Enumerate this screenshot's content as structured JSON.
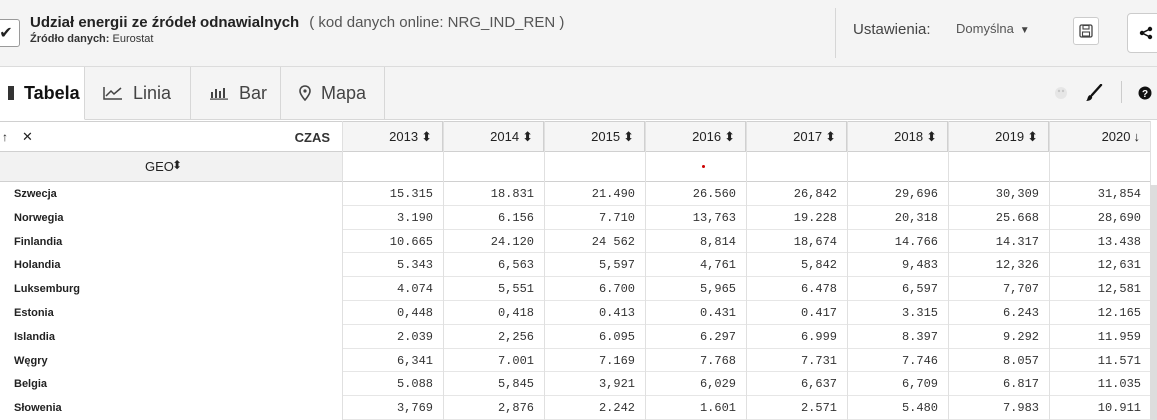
{
  "header": {
    "check_mark": "✔",
    "title": "Udział energii ze źródeł odnawialnych",
    "code": "( kod danych online: NRG_IND_REN )",
    "source_label": "Źródło danych:",
    "source_value": "Eurostat",
    "settings_label": "Ustawienia:",
    "settings_value": "Domyślna"
  },
  "tabs": [
    {
      "label": "Tabela",
      "icon": "table-icon"
    },
    {
      "label": "Linia",
      "icon": "line-chart-icon"
    },
    {
      "label": "Bar",
      "icon": "bar-chart-icon"
    },
    {
      "label": "Mapa",
      "icon": "map-pin-icon"
    }
  ],
  "table": {
    "time_label": "CZAS",
    "geo_label": "GEO",
    "years": [
      "2013",
      "2014",
      "2015",
      "2016",
      "2017",
      "2018",
      "2019",
      "2020"
    ],
    "rows": [
      {
        "geo": "Szwecja",
        "values": [
          "15.315",
          "18.831",
          "21.490",
          "26.560",
          "26,842",
          "29,696",
          "30,309",
          "31,854"
        ]
      },
      {
        "geo": "Norwegia",
        "values": [
          "3.190",
          "6.156",
          "7.710",
          "13,763",
          "19.228",
          "20,318",
          "25.668",
          "28,690"
        ]
      },
      {
        "geo": "Finlandia",
        "values": [
          "10.665",
          "24.120",
          "24 562",
          "8,814",
          "18,674",
          "14.766",
          "14.317",
          "13.438"
        ]
      },
      {
        "geo": "Holandia",
        "values": [
          "5.343",
          "6,563",
          "5,597",
          "4,761",
          "5,842",
          "9,483",
          "12,326",
          "12,631"
        ]
      },
      {
        "geo": "Luksemburg",
        "values": [
          "4.074",
          "5,551",
          "6.700",
          "5,965",
          "6.478",
          "6,597",
          "7,707",
          "12,581"
        ]
      },
      {
        "geo": "Estonia",
        "values": [
          "0,448",
          "0,418",
          "0.413",
          "0.431",
          "0.417",
          "3.315",
          "6.243",
          "12.165"
        ]
      },
      {
        "geo": "Islandia",
        "values": [
          "2.039",
          "2,256",
          "6.095",
          "6.297",
          "6.999",
          "8.397",
          "9.292",
          "11.959"
        ]
      },
      {
        "geo": "Węgry",
        "values": [
          "6,341",
          "7.001",
          "7.169",
          "7.768",
          "7.731",
          "7.746",
          "8.057",
          "11.571"
        ]
      },
      {
        "geo": "Belgia",
        "values": [
          "5.088",
          "5,845",
          "3,921",
          "6,029",
          "6,637",
          "6,709",
          "6.817",
          "11.035"
        ]
      },
      {
        "geo": "Słowenia",
        "values": [
          "3,769",
          "2,876",
          "2.242",
          "1.601",
          "2.571",
          "5.480",
          "7.983",
          "10.911"
        ]
      }
    ]
  },
  "colors": {
    "accent_dot": "#cc0000",
    "header_bg": "#f4f4f4"
  }
}
